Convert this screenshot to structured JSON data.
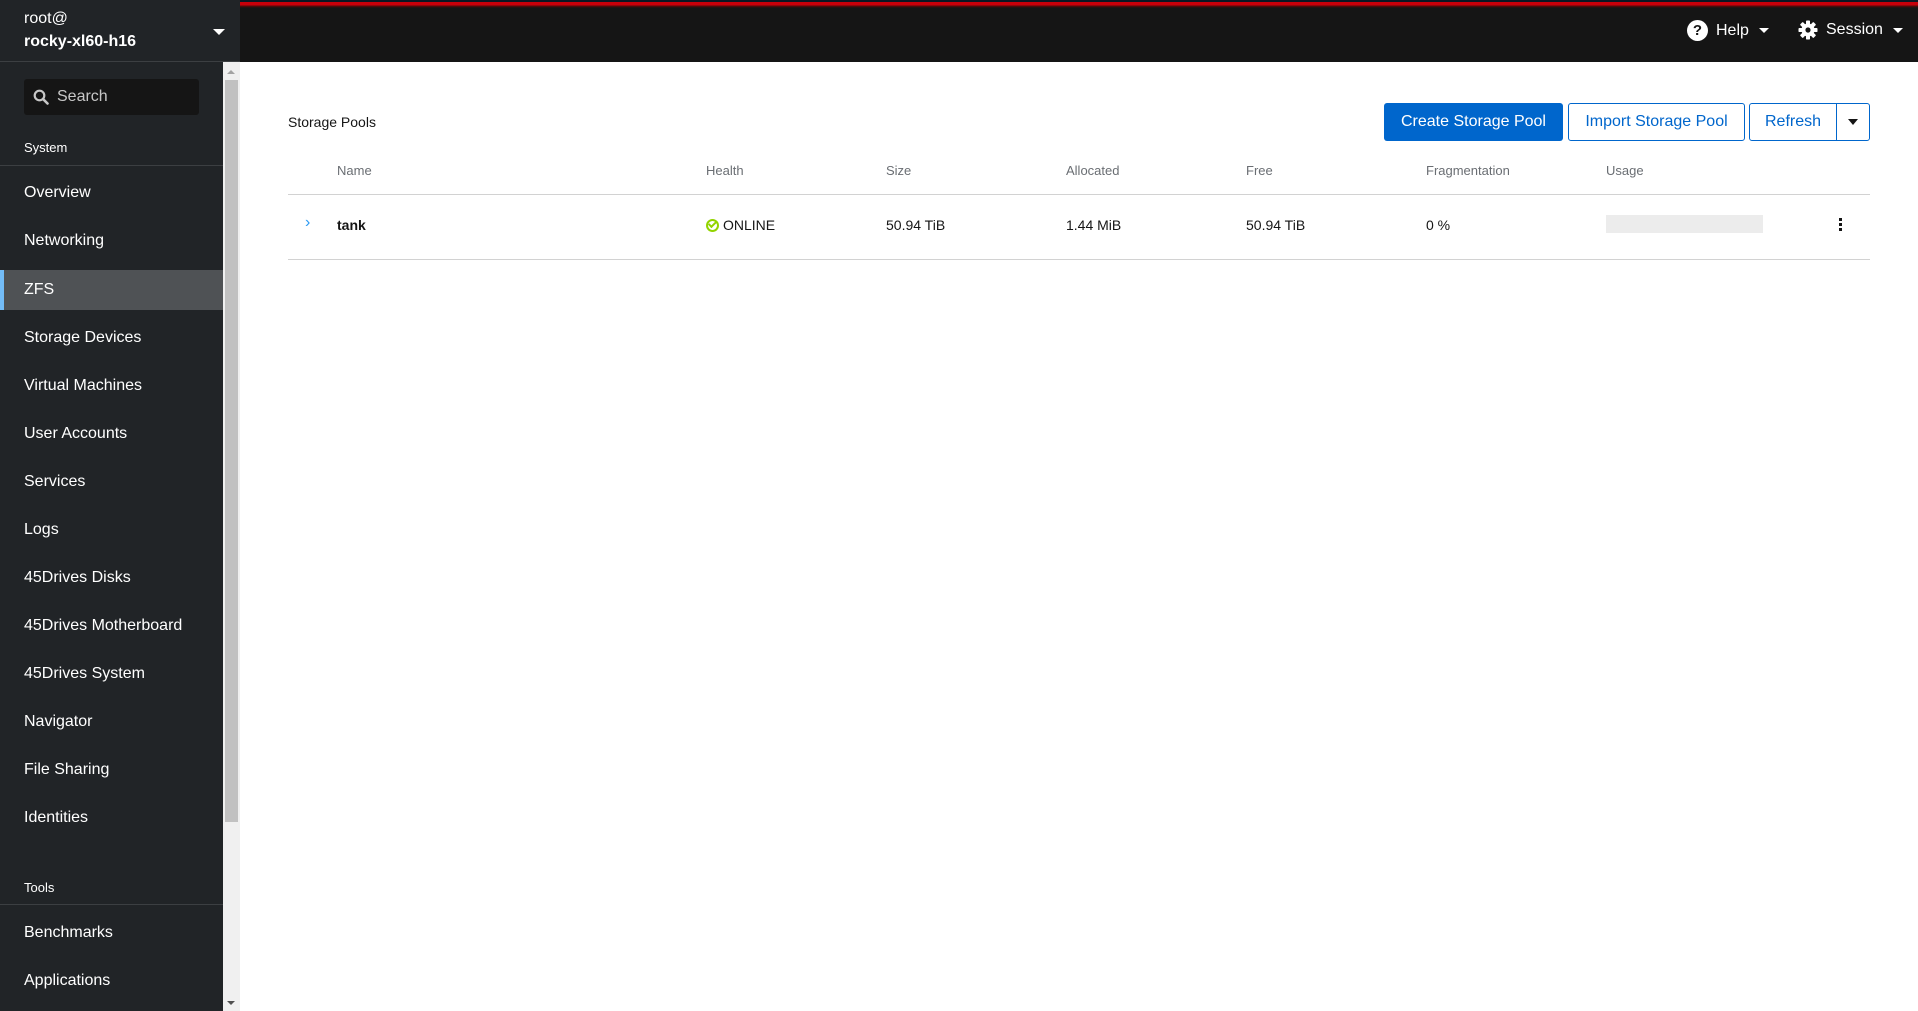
{
  "host": {
    "user": "root@",
    "hostname": "rocky-xl60-h16"
  },
  "header": {
    "help_label": "Help",
    "session_label": "Session"
  },
  "sidebar": {
    "search_placeholder": "Search",
    "sections": [
      {
        "label": "System",
        "items": [
          {
            "label": "Overview",
            "active": false
          },
          {
            "label": "Networking",
            "active": false
          },
          {
            "label": "ZFS",
            "active": true
          },
          {
            "label": "Storage Devices",
            "active": false
          },
          {
            "label": "Virtual Machines",
            "active": false
          },
          {
            "label": "User Accounts",
            "active": false
          },
          {
            "label": "Services",
            "active": false
          },
          {
            "label": "Logs",
            "active": false
          },
          {
            "label": "45Drives Disks",
            "active": false
          },
          {
            "label": "45Drives Motherboard",
            "active": false
          },
          {
            "label": "45Drives System",
            "active": false
          },
          {
            "label": "Navigator",
            "active": false
          },
          {
            "label": "File Sharing",
            "active": false
          },
          {
            "label": "Identities",
            "active": false
          }
        ]
      },
      {
        "label": "Tools",
        "items": [
          {
            "label": "Benchmarks",
            "active": false
          },
          {
            "label": "Applications",
            "active": false
          }
        ]
      }
    ]
  },
  "main": {
    "title": "Storage Pools",
    "buttons": {
      "create": "Create Storage Pool",
      "import": "Import Storage Pool",
      "refresh": "Refresh"
    },
    "table": {
      "columns": [
        "Name",
        "Health",
        "Size",
        "Allocated",
        "Free",
        "Fragmentation",
        "Usage"
      ],
      "rows": [
        {
          "name": "tank",
          "health": "ONLINE",
          "size": "50.94 TiB",
          "allocated": "1.44 MiB",
          "free": "50.94 TiB",
          "fragmentation": "0 %",
          "usage_percent": 0
        }
      ]
    }
  },
  "colors": {
    "accent": "#0066cc",
    "active_nav_marker": "#73bcf7",
    "health_ok": "#92d400",
    "header_red": "#c8000a"
  }
}
